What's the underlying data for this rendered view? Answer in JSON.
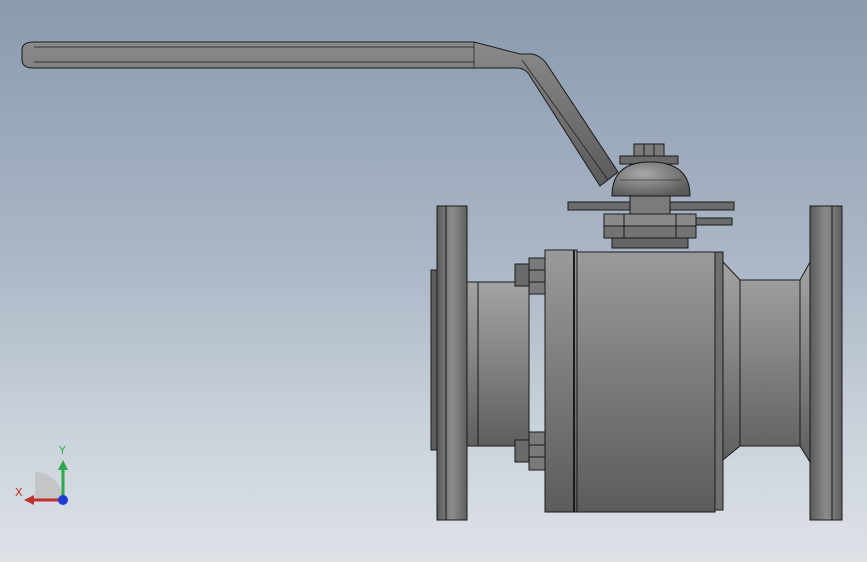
{
  "viewport": {
    "background_top": "#8a9bb0",
    "background_bottom": "#dde2e7"
  },
  "model": {
    "part_color": "#6e6e6e",
    "edge_color": "#1a1a1a"
  },
  "triad": {
    "x_label": "X",
    "y_label": "Y",
    "x_color": "#c0302c",
    "y_color": "#2ea84a",
    "z_color": "#1f3bd6"
  }
}
